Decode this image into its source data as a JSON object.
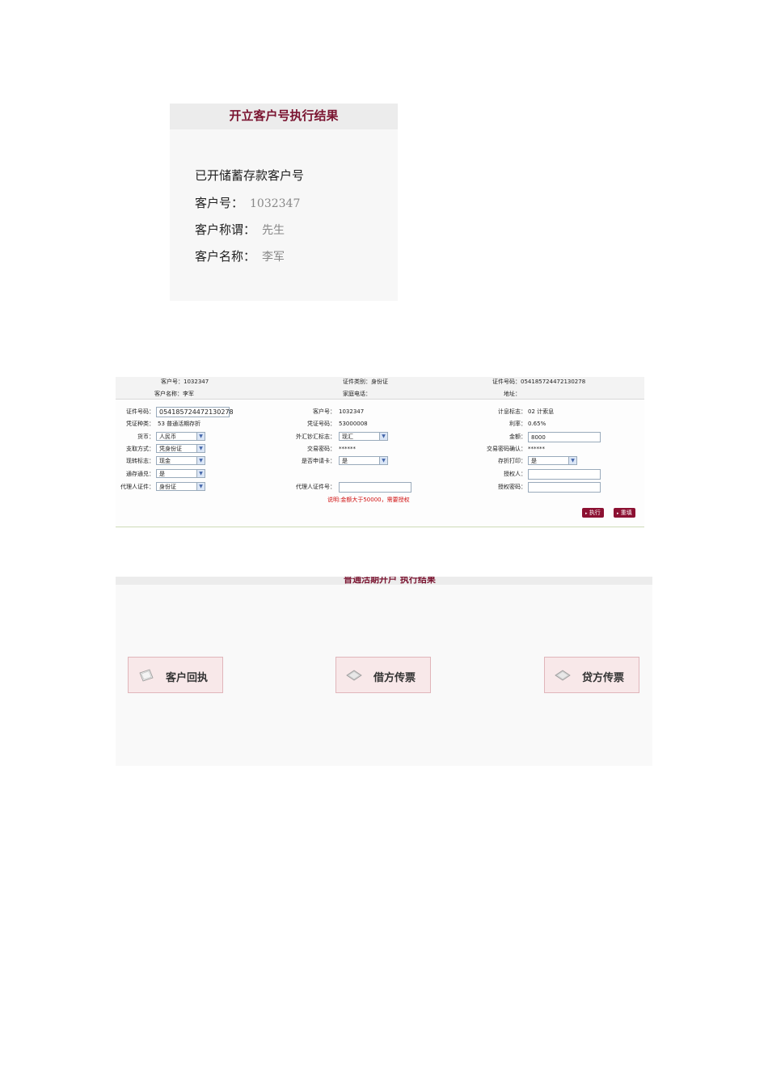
{
  "panel1": {
    "title": "开立客户号执行结果",
    "heading": "已开储蓄存款客户号",
    "customer_no_label": "客户号：",
    "customer_no": "1032347",
    "title_label": "客户称谓：",
    "title_value": "先生",
    "name_label": "客户名称：",
    "name_value": "李军"
  },
  "panel2": {
    "header": {
      "customer_no": "客户号：1032347",
      "id_type": "证件类别：身份证",
      "id_no": "证件号码：054185724472130278",
      "customer_name": "客户名称：李军",
      "home_phone": "家庭电话：",
      "address": "地址："
    },
    "form": {
      "id_no_label": "证件号码：",
      "id_no_value": "054185724472130278",
      "customer_no_label": "客户号：",
      "customer_no_value": "1032347",
      "interest_label": "计息标志：",
      "interest_value": "02 计索息",
      "voucher_type_label": "凭证种类：",
      "voucher_type_value": "53 普通活期存折",
      "voucher_no_label": "凭证号码：",
      "voucher_no_value": "53000008",
      "rate_label": "利率：",
      "rate_value": "0.65%",
      "currency_label": "货币：",
      "currency_value": "人民币",
      "fx_label": "外汇钞汇标志：",
      "fx_value": "现汇",
      "amount_label": "金额：",
      "amount_value": "8000",
      "withdraw_label": "支取方式：",
      "withdraw_value": "凭身份证",
      "pwd_label": "交易密码：",
      "pwd_value": "******",
      "pwd_confirm_label": "交易密码确认：",
      "pwd_confirm_value": "******",
      "cash_label": "现转标志：",
      "cash_value": "现金",
      "card_label": "是否申请卡：",
      "card_value": "是",
      "print_label": "存折打印：",
      "print_value": "是",
      "auto_label": "通存通兑：",
      "auto_value": "是",
      "authorizer_label": "授权人：",
      "authorizer_value": "",
      "agent_id_label": "代理人证件：",
      "agent_id_value": "身份证",
      "agent_id_no_label": "代理人证件号：",
      "agent_id_no_value": "",
      "auth_pwd_label": "授权密码：",
      "auth_pwd_value": ""
    },
    "note": "说明:金额大于50000，需要授权",
    "execute_label": "执行",
    "reset_label": "重填"
  },
  "panel3": {
    "title": "普通活期开户 执行结果",
    "buttons": [
      {
        "label": "客户回执",
        "icon": "receipt-icon"
      },
      {
        "label": "借方传票",
        "icon": "voucher-icon"
      },
      {
        "label": "贷方传票",
        "icon": "voucher-icon"
      }
    ]
  },
  "colors": {
    "title_maroon": "#7a1430",
    "button_maroon": "#8c1132",
    "note_red": "#d01010",
    "print_button_bg": "#f8e8e9"
  }
}
